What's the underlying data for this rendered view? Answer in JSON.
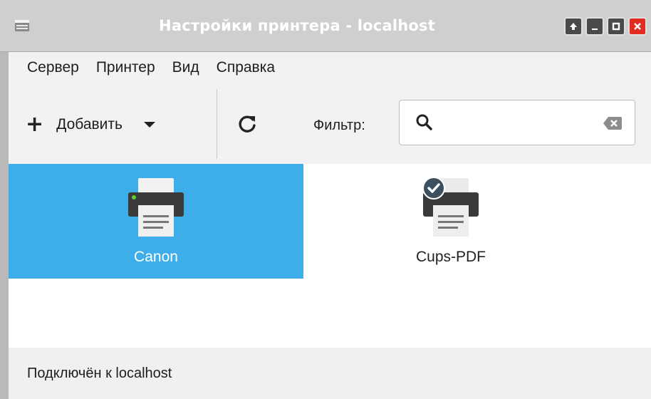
{
  "window": {
    "title": "Настройки принтера - localhost",
    "buttons": [
      "keep-above",
      "minimize",
      "maximize",
      "close"
    ]
  },
  "menu": {
    "items": [
      {
        "label": "Сервер"
      },
      {
        "label": "Принтер"
      },
      {
        "label": "Вид"
      },
      {
        "label": "Справка"
      }
    ]
  },
  "toolbar": {
    "add_label": "Добавить",
    "filter_label": "Фильтр:",
    "filter_value": "",
    "filter_placeholder": ""
  },
  "printers": [
    {
      "name": "Canon",
      "selected": true,
      "default": false,
      "status_color": "#5ccd37"
    },
    {
      "name": "Cups-PDF",
      "selected": false,
      "default": true
    }
  ],
  "status": {
    "text": "Подключён к localhost"
  },
  "colors": {
    "accent": "#3daee9",
    "close": "#e32b20",
    "titlebar": "#cfcfcf"
  }
}
